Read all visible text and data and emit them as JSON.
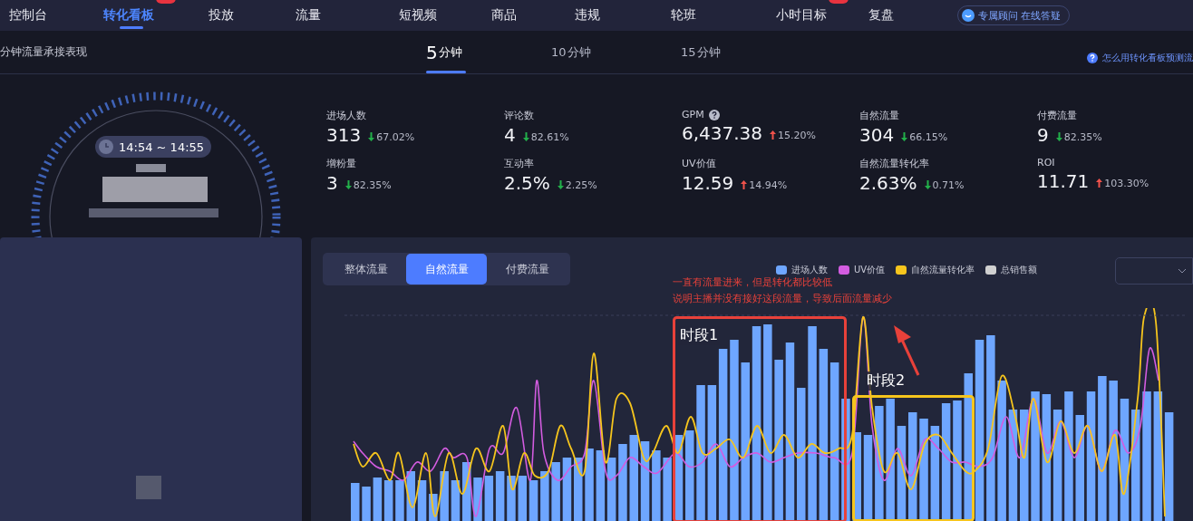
{
  "nav": {
    "items": [
      {
        "label": "控制台",
        "selected": false,
        "badge": false
      },
      {
        "label": "转化看板",
        "selected": true,
        "badge": true
      },
      {
        "label": "投放",
        "selected": false,
        "badge": false
      },
      {
        "label": "流量",
        "selected": false,
        "badge": false
      },
      {
        "label": "短视频",
        "selected": false,
        "badge": false
      },
      {
        "label": "商品",
        "selected": false,
        "badge": false
      },
      {
        "label": "违规",
        "selected": false,
        "badge": false
      },
      {
        "label": "轮班",
        "selected": false,
        "badge": false
      },
      {
        "label": "小时目标",
        "selected": false,
        "badge": true
      },
      {
        "label": "复盘",
        "selected": false,
        "badge": false
      }
    ],
    "advisor_button": "专属顾问 在线答疑"
  },
  "subheader": {
    "title": "分钟流量承接表现",
    "intervals": [
      {
        "number": "5",
        "unit": "分钟",
        "selected": true
      },
      {
        "number": "10",
        "unit": "分钟",
        "selected": false
      },
      {
        "number": "15",
        "unit": "分钟",
        "selected": false
      }
    ],
    "help_link": "怎么用转化看板预测流"
  },
  "time_range": "14:54 ~ 14:55",
  "metrics": [
    {
      "label": "进场人数",
      "value": "313",
      "change": "67.02%",
      "rising": false
    },
    {
      "label": "评论数",
      "value": "4",
      "change": "82.61%",
      "rising": false
    },
    {
      "label": "GPM",
      "value": "6,437.38",
      "change": "15.20%",
      "rising": true,
      "help_icon": true
    },
    {
      "label": "自然流量",
      "value": "304",
      "change": "66.15%",
      "rising": false
    },
    {
      "label": "付费流量",
      "value": "9",
      "change": "82.35%",
      "rising": false
    },
    {
      "label": "增粉量",
      "value": "3",
      "change": "82.35%",
      "rising": false
    },
    {
      "label": "互动率",
      "value": "2.5%",
      "change": "2.25%",
      "rising": false
    },
    {
      "label": "UV价值",
      "value": "12.59",
      "change": "14.94%",
      "rising": true
    },
    {
      "label": "自然流量转化率",
      "value": "2.63%",
      "change": "0.71%",
      "rising": false
    },
    {
      "label": "ROI",
      "value": "11.71",
      "change": "103.30%",
      "rising": true
    }
  ],
  "chart_panel": {
    "tabs": [
      {
        "label": "整体流量",
        "selected": false
      },
      {
        "label": "自然流量",
        "selected": true
      },
      {
        "label": "付费流量",
        "selected": false
      }
    ],
    "legend": [
      {
        "label": "进场人数",
        "color": "#6ea6ff"
      },
      {
        "label": "UV价值",
        "color": "#d35ce0"
      },
      {
        "label": "自然流量转化率",
        "color": "#f6c51d"
      },
      {
        "label": "总销售额",
        "color": "#d0d0d0"
      }
    ],
    "note": [
      "一直有流量进来，但是转化都比较低",
      "说明主播并没有接好这段流量，导致后面流量减少"
    ],
    "periods": [
      {
        "label": "时段1",
        "color": "#e8413a"
      },
      {
        "label": "时段2",
        "color": "#f6c51d"
      }
    ]
  }
}
